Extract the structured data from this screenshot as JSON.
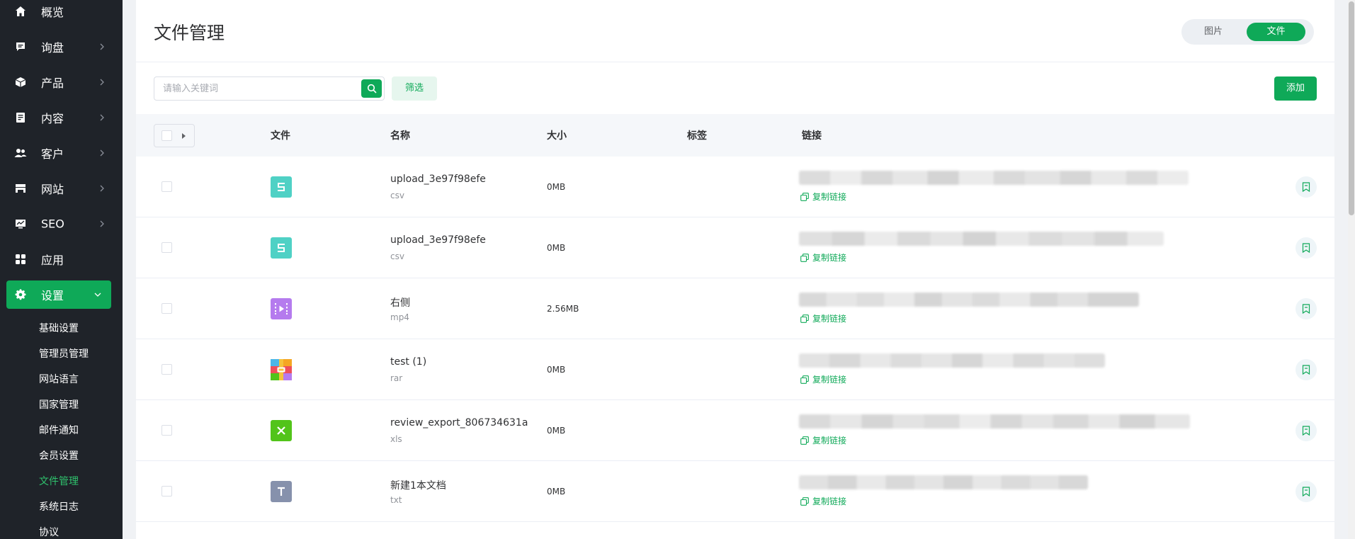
{
  "sidebar": {
    "items": [
      {
        "label": "概览",
        "icon": "home-icon"
      },
      {
        "label": "询盘",
        "icon": "message-icon"
      },
      {
        "label": "产品",
        "icon": "box-icon"
      },
      {
        "label": "内容",
        "icon": "document-icon"
      },
      {
        "label": "客户",
        "icon": "users-icon"
      },
      {
        "label": "网站",
        "icon": "website-icon"
      },
      {
        "label": "SEO",
        "icon": "chart-icon"
      },
      {
        "label": "应用",
        "icon": "apps-icon"
      },
      {
        "label": "设置",
        "icon": "gear-icon"
      }
    ],
    "sub_items": [
      "基础设置",
      "管理员管理",
      "网站语言",
      "国家管理",
      "邮件通知",
      "会员设置",
      "文件管理",
      "系统日志",
      "协议"
    ],
    "active_sub_item": "文件管理"
  },
  "header": {
    "title": "文件管理",
    "tabs": [
      "图片",
      "文件"
    ],
    "active_tab": "文件"
  },
  "toolbar": {
    "search_placeholder": "请输入关键词",
    "filter_label": "筛选",
    "add_label": "添加"
  },
  "table": {
    "columns": [
      "文件",
      "名称",
      "大小",
      "标签",
      "链接"
    ],
    "copy_link_label": "复制链接",
    "rows": [
      {
        "name": "upload_3e97f98efe",
        "ext": "csv",
        "size": "0MB",
        "icon": "csv-file-icon",
        "tag": ""
      },
      {
        "name": "upload_3e97f98efe",
        "ext": "csv",
        "size": "0MB",
        "icon": "csv-file-icon",
        "tag": ""
      },
      {
        "name": "右侧",
        "ext": "mp4",
        "size": "2.56MB",
        "icon": "video-file-icon",
        "tag": ""
      },
      {
        "name": "test (1)",
        "ext": "rar",
        "size": "0MB",
        "icon": "archive-file-icon",
        "tag": ""
      },
      {
        "name": "review_export_806734631a",
        "ext": "xls",
        "size": "0MB",
        "icon": "excel-file-icon",
        "tag": ""
      },
      {
        "name": "新建1本文档",
        "ext": "txt",
        "size": "0MB",
        "icon": "text-file-icon",
        "tag": ""
      }
    ]
  },
  "colors": {
    "accent": "#0fa958",
    "sidebar_bg": "#1f2329",
    "csv_icon": "#4fd1c5",
    "video_icon": "#b57bee",
    "excel_icon": "#52c41a",
    "text_icon": "#8691ac"
  }
}
